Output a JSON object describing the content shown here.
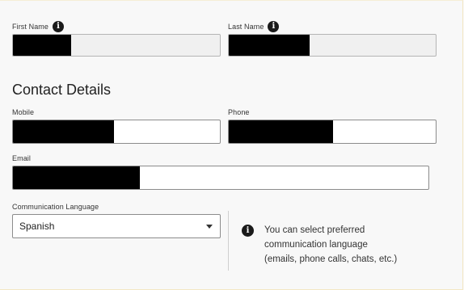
{
  "name": {
    "first_name_label": "First Name",
    "last_name_label": "Last Name"
  },
  "contact": {
    "section_title": "Contact Details",
    "mobile_label": "Mobile",
    "phone_label": "Phone",
    "email_label": "Email"
  },
  "language": {
    "label": "Communication Language",
    "selected": "Spanish",
    "hint_lines": [
      "You can select preferred",
      "communication language",
      "(emails, phone calls, chats, etc.)"
    ]
  },
  "icons": {
    "info": "i"
  }
}
